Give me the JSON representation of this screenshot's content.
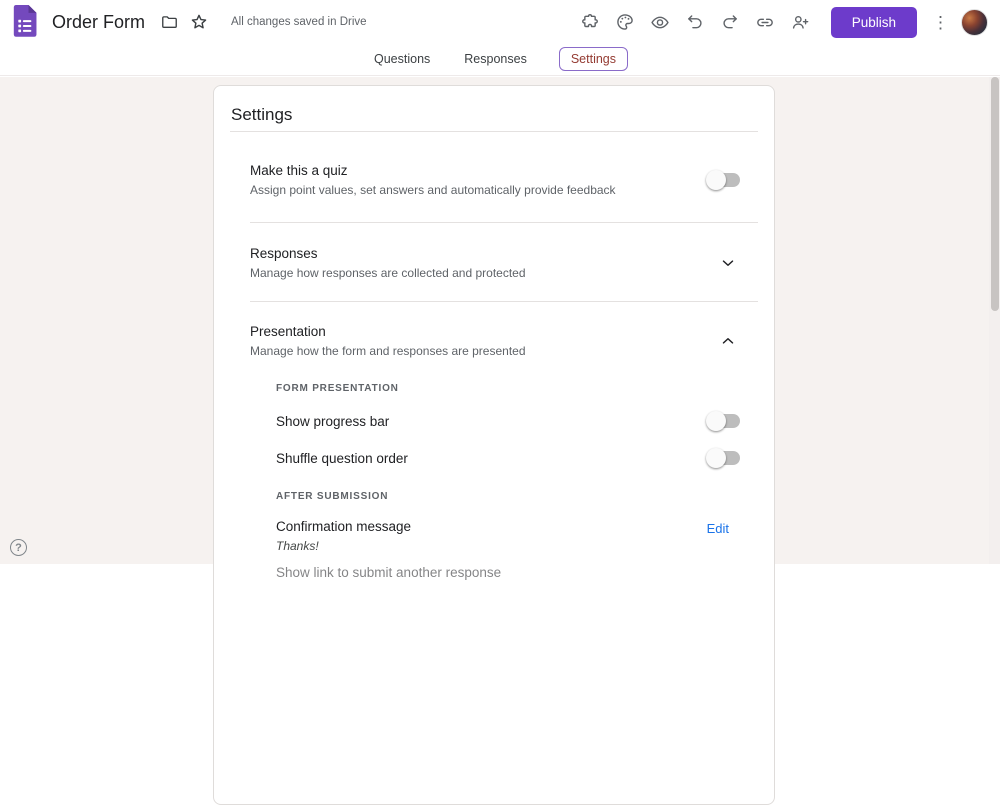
{
  "header": {
    "title": "Order Form",
    "saved_status": "All changes saved in Drive",
    "publish_label": "Publish",
    "icons": [
      "forms-logo",
      "folder-icon",
      "star-icon",
      "extensions-icon",
      "palette-icon",
      "preview-icon",
      "undo-icon",
      "redo-icon",
      "link-icon",
      "add-collaborator-icon",
      "more-menu-icon",
      "avatar"
    ]
  },
  "tabs": [
    {
      "label": "Questions",
      "selected": false
    },
    {
      "label": "Responses",
      "selected": false
    },
    {
      "label": "Settings",
      "selected": true
    }
  ],
  "settings_panel": {
    "heading": "Settings",
    "quiz": {
      "title": "Make this a quiz",
      "description": "Assign point values, set answers and automatically provide feedback",
      "toggle": "off"
    },
    "responses": {
      "title": "Responses",
      "description": "Manage how responses are collected and protected",
      "state": "collapsed"
    },
    "presentation": {
      "title": "Presentation",
      "description": "Manage how the form and responses are presented",
      "state": "expanded",
      "groups": [
        {
          "label": "FORM PRESENTATION",
          "rows": [
            {
              "title": "Show progress bar",
              "toggle": "off"
            },
            {
              "title": "Shuffle question order",
              "toggle": "off"
            }
          ]
        },
        {
          "label": "AFTER SUBMISSION",
          "rows": [
            {
              "title": "Confirmation message",
              "value": "Thanks!",
              "action": "Edit"
            }
          ]
        }
      ],
      "partial_next_row": "Show link to submit another response"
    }
  },
  "help_label": "?",
  "colors": {
    "publish_bg": "#6d3bcb",
    "forms_purple": "#7248b9",
    "tab_selected_text": "#943b32",
    "tab_selected_border": "#8a6bc9",
    "edit_link": "#1a73e8",
    "icon_gray": "#5f6368",
    "text_primary": "#202124",
    "text_secondary": "#5f6368",
    "page_background": "#f6f2f0"
  }
}
